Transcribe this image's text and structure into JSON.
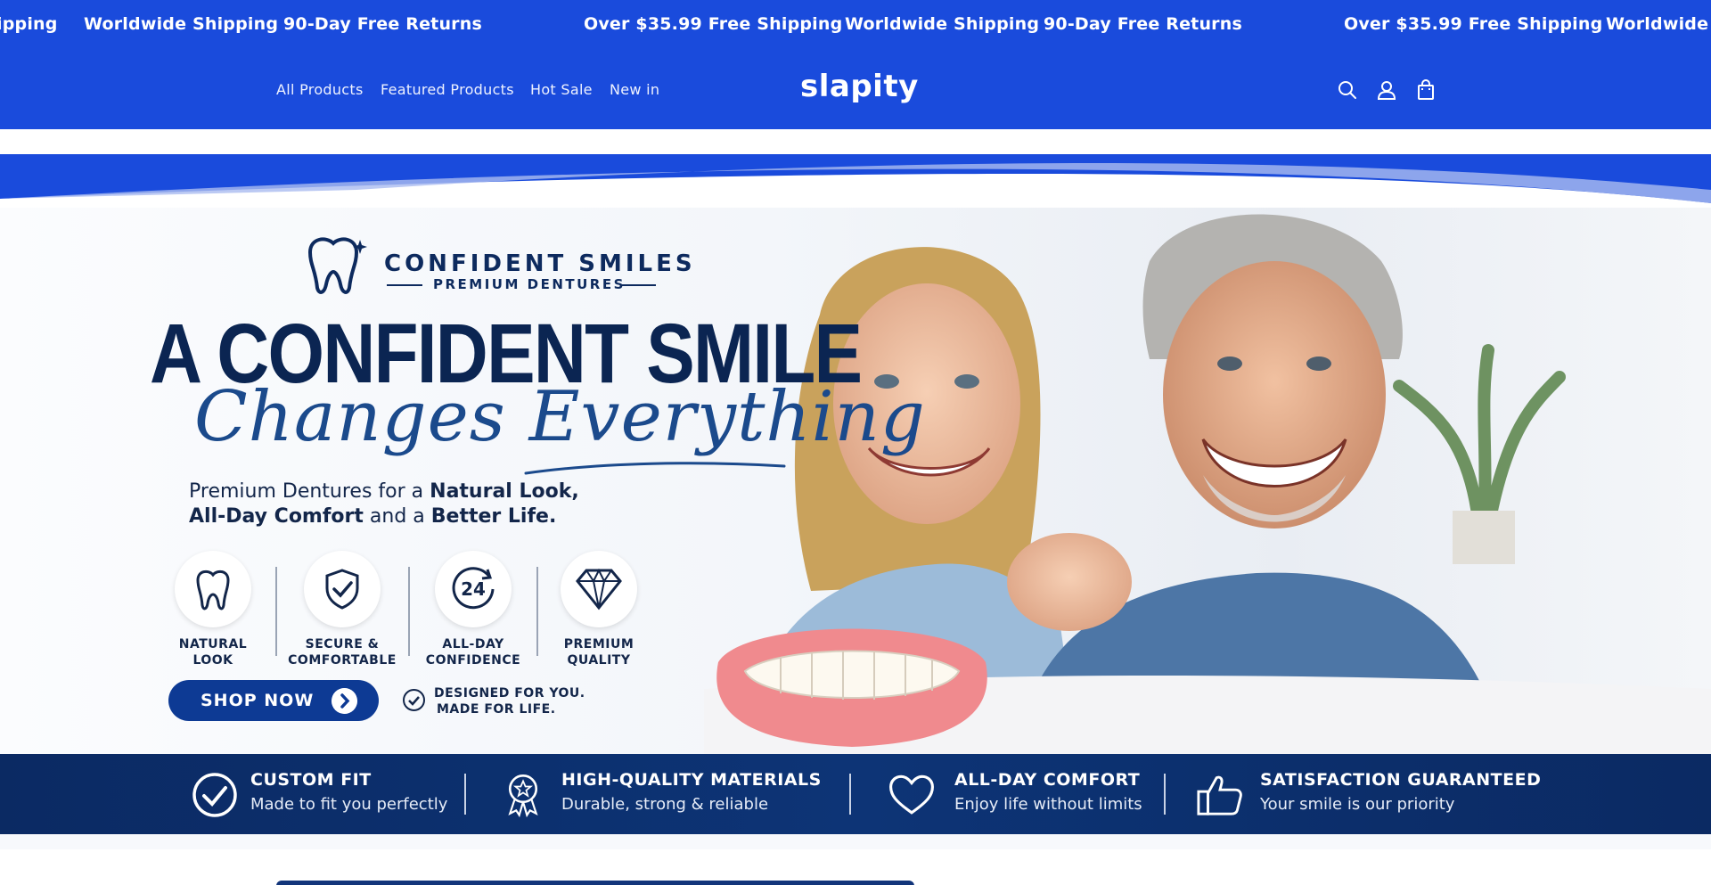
{
  "announcement": {
    "items": [
      "ipping",
      "Worldwide Shipping",
      "90-Day Free Returns",
      "Over $35.99 Free Shipping",
      "Worldwide Shipping",
      "90-Day Free Returns",
      "Over $35.99 Free Shipping",
      "Worldwide S"
    ]
  },
  "header": {
    "nav": [
      "All Products",
      "Featured Products",
      "Hot Sale",
      "New in"
    ],
    "logo": "slapity",
    "icons": [
      "search-icon",
      "account-icon",
      "cart-icon"
    ]
  },
  "hero": {
    "brand_name": "CONFIDENT SMILES",
    "brand_sub": "PREMIUM DENTURES",
    "headline": "A CONFIDENT SMILE",
    "script": "Changes Everything",
    "tagline_line1_a": "Premium Dentures for a ",
    "tagline_line1_b": "Natural Look,",
    "tagline_line2_a": "All-Day Comfort",
    "tagline_line2_b": " and a ",
    "tagline_line2_c": "Better Life.",
    "features": [
      {
        "label": "NATURAL\nLOOK",
        "icon": "tooth-icon"
      },
      {
        "label": "SECURE &\nCOMFORTABLE",
        "icon": "shield-check-icon"
      },
      {
        "label": "ALL-DAY\nCONFIDENCE",
        "icon": "24-hour-icon",
        "badge": "24"
      },
      {
        "label": "PREMIUM\nQUALITY",
        "icon": "diamond-icon"
      }
    ],
    "cta": "SHOP NOW",
    "designed_line1": "DESIGNED FOR YOU.",
    "designed_line2": "MADE FOR LIFE."
  },
  "benefits": [
    {
      "title": "CUSTOM FIT",
      "sub": "Made to fit you perfectly",
      "icon": "check-circle-icon"
    },
    {
      "title": "HIGH-QUALITY MATERIALS",
      "sub": "Durable, strong & reliable",
      "icon": "award-badge-icon"
    },
    {
      "title": "ALL-DAY COMFORT",
      "sub": "Enjoy life without limits",
      "icon": "heart-icon"
    },
    {
      "title": "SATISFACTION GUARANTEED",
      "sub": "Your smile is our priority",
      "icon": "thumbs-up-icon"
    }
  ],
  "colors": {
    "brand_blue": "#1a4bdc",
    "navy": "#0b2552",
    "benefits_bar": "#0b2a63"
  }
}
